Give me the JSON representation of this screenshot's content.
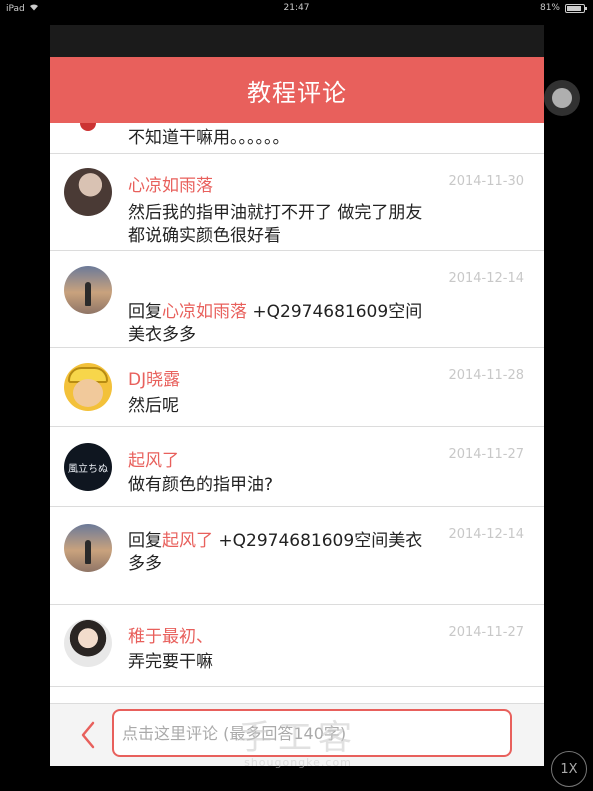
{
  "status_bar": {
    "device": "iPad",
    "time": "21:47",
    "battery": "81%"
  },
  "header": {
    "title": "教程评论"
  },
  "partial_comment": {
    "text": "不知道干嘛用。。。。。。"
  },
  "comments": [
    {
      "username": "心凉如雨落",
      "date": "2014-11-30",
      "text": "然后我的指甲油就打不开了 做完了朋友都说确实颜色很好看",
      "avatar": "avatar-dark"
    },
    {
      "username": "",
      "date": "2014-12-14",
      "reply_prefix": "回复",
      "mention": "心凉如雨落",
      "text": " +Q2974681609空间美衣多多",
      "avatar": "avatar-sunset"
    },
    {
      "username": "DJ晓露",
      "date": "2014-11-28",
      "text": "然后呢",
      "avatar": "avatar-cartoon"
    },
    {
      "username": "起风了",
      "date": "2014-11-27",
      "text": "做有颜色的指甲油?",
      "avatar": "avatar-badge",
      "avatar_text": "風立ちぬ"
    },
    {
      "username": "",
      "date": "2014-12-14",
      "reply_prefix": "回复",
      "mention": "起风了",
      "text": " +Q2974681609空间美衣多多",
      "avatar": "avatar-sunset"
    },
    {
      "username": "稚于最初、",
      "date": "2014-11-27",
      "text": "弄完要干嘛",
      "avatar": "avatar-girl"
    }
  ],
  "footer": {
    "back_icon": "chevron-left-icon",
    "input_placeholder": "点击这里评论 (最多回答140字)"
  },
  "watermark": {
    "main": "手工客",
    "sub": "shougongke.com"
  },
  "overlay": {
    "zoom_label": "1X"
  },
  "colors": {
    "accent": "#e8605c",
    "date": "#c8c8c8",
    "divider": "#dcdcdc"
  }
}
